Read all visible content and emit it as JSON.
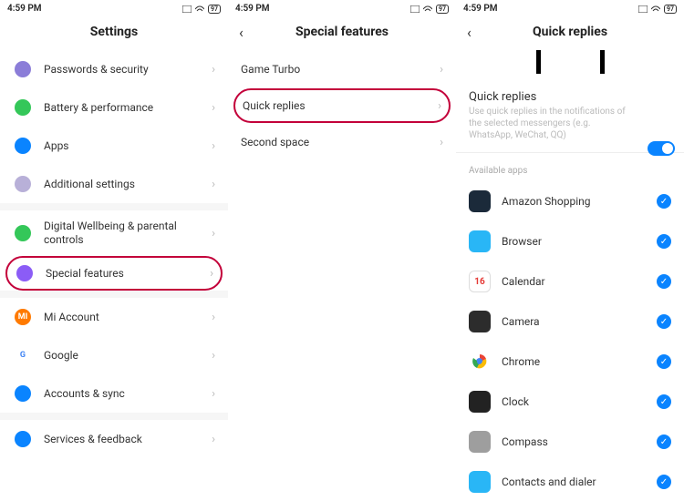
{
  "status": {
    "time": "4:59 PM",
    "battery": "97"
  },
  "panel1": {
    "title": "Settings",
    "items": [
      {
        "label": "Passwords & security",
        "icon_name": "fingerprint-icon",
        "icon_color": "#8b7dd8"
      },
      {
        "label": "Battery & performance",
        "icon_name": "battery-icon",
        "icon_color": "#34c759"
      },
      {
        "label": "Apps",
        "icon_name": "apps-icon",
        "icon_color": "#0a84ff"
      },
      {
        "label": "Additional settings",
        "icon_name": "additional-icon",
        "icon_color": "#b8b0d8"
      }
    ],
    "items2": [
      {
        "label": "Digital Wellbeing & parental controls",
        "icon_name": "wellbeing-icon",
        "icon_color": "#34c759"
      },
      {
        "label": "Special features",
        "icon_name": "special-features-icon",
        "icon_color": "#8b5cf6",
        "highlighted": true
      }
    ],
    "items3": [
      {
        "label": "Mi Account",
        "icon_name": "mi-icon",
        "icon_color": "#ff7a00",
        "text": "MI"
      },
      {
        "label": "Google",
        "icon_name": "google-icon",
        "icon_color": "#fff",
        "text": "G"
      },
      {
        "label": "Accounts & sync",
        "icon_name": "accounts-icon",
        "icon_color": "#0a84ff"
      }
    ],
    "items4": [
      {
        "label": "Services & feedback",
        "icon_name": "services-icon",
        "icon_color": "#0a84ff"
      }
    ]
  },
  "panel2": {
    "title": "Special features",
    "items": [
      {
        "label": "Game Turbo"
      },
      {
        "label": "Quick replies",
        "highlighted": true
      },
      {
        "label": "Second space"
      }
    ]
  },
  "panel3": {
    "title": "Quick replies",
    "toggle_title": "Quick replies",
    "toggle_sub": "Use quick replies in the notifications of the selected messengers (e.g. WhatsApp, WeChat, QQ)",
    "section": "Available apps",
    "apps": [
      {
        "label": "Amazon Shopping",
        "bg": "#1b2a3a"
      },
      {
        "label": "Browser",
        "bg": "#29b6f6"
      },
      {
        "label": "Calendar",
        "bg": "#ffffff",
        "text": "16",
        "fg": "#e53935",
        "border": true
      },
      {
        "label": "Camera",
        "bg": "#2c2c2c"
      },
      {
        "label": "Chrome",
        "bg": "#fff",
        "chrome": true
      },
      {
        "label": "Clock",
        "bg": "#222"
      },
      {
        "label": "Compass",
        "bg": "#9e9e9e"
      },
      {
        "label": "Contacts and dialer",
        "bg": "#29b6f6"
      }
    ]
  }
}
